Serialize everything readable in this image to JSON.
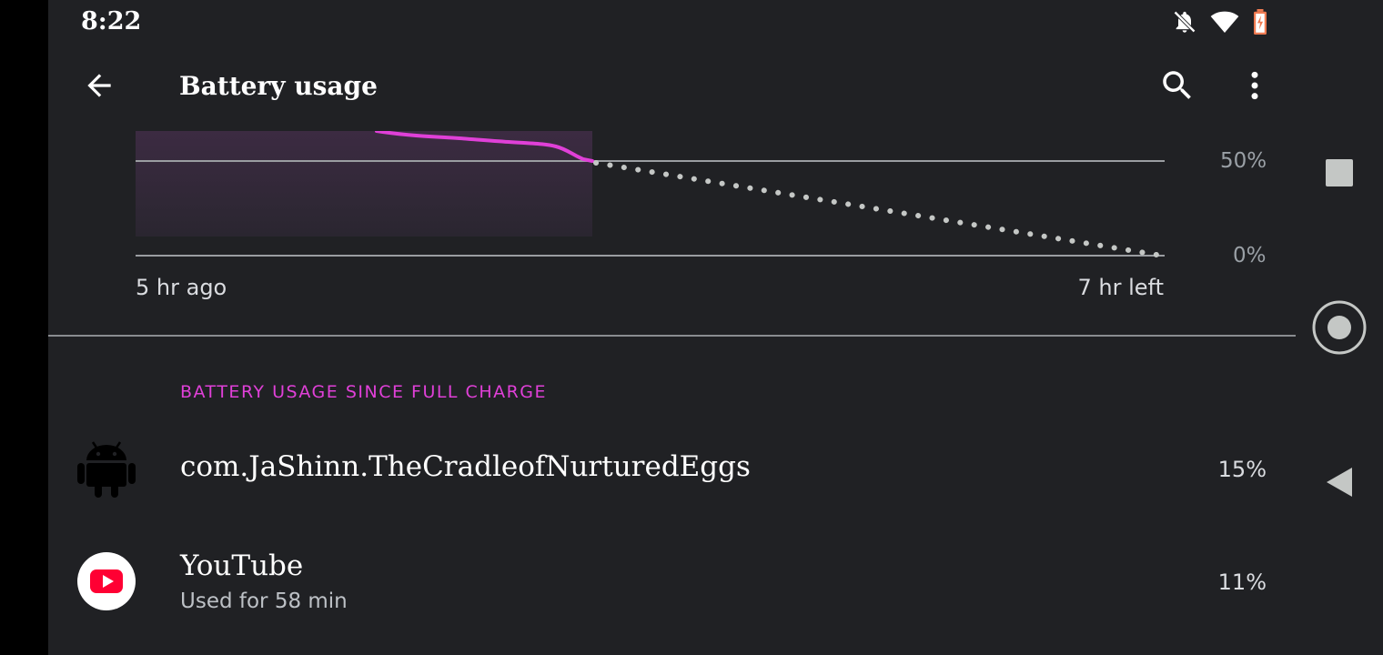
{
  "status_bar": {
    "time": "8:22",
    "icons": [
      "notifications-off-icon",
      "wifi-icon",
      "battery-charging-icon"
    ]
  },
  "app_bar": {
    "title": "Battery usage",
    "back_icon": "arrow-back-icon",
    "search_icon": "search-icon",
    "more_icon": "more-vert-icon"
  },
  "chart": {
    "y_labels": [
      "50%",
      "0%"
    ],
    "start_label": "5 hr ago",
    "end_label": "7 hr left",
    "colors": {
      "used_line": "#e040d8",
      "projection": "#c4c7c5",
      "fill": "#3a2a3e"
    }
  },
  "section": {
    "header": "BATTERY USAGE SINCE FULL CHARGE"
  },
  "apps": [
    {
      "name": "com.JaShinn.TheCradleofNurturedEggs",
      "subtitle": "",
      "percent": "15%",
      "icon": "android-icon"
    },
    {
      "name": "YouTube",
      "subtitle": "Used for 58 min",
      "percent": "11%",
      "icon": "youtube-icon"
    }
  ],
  "nav_bar": {
    "icons": [
      "recents-square-icon",
      "home-circle-icon",
      "back-triangle-icon"
    ]
  }
}
